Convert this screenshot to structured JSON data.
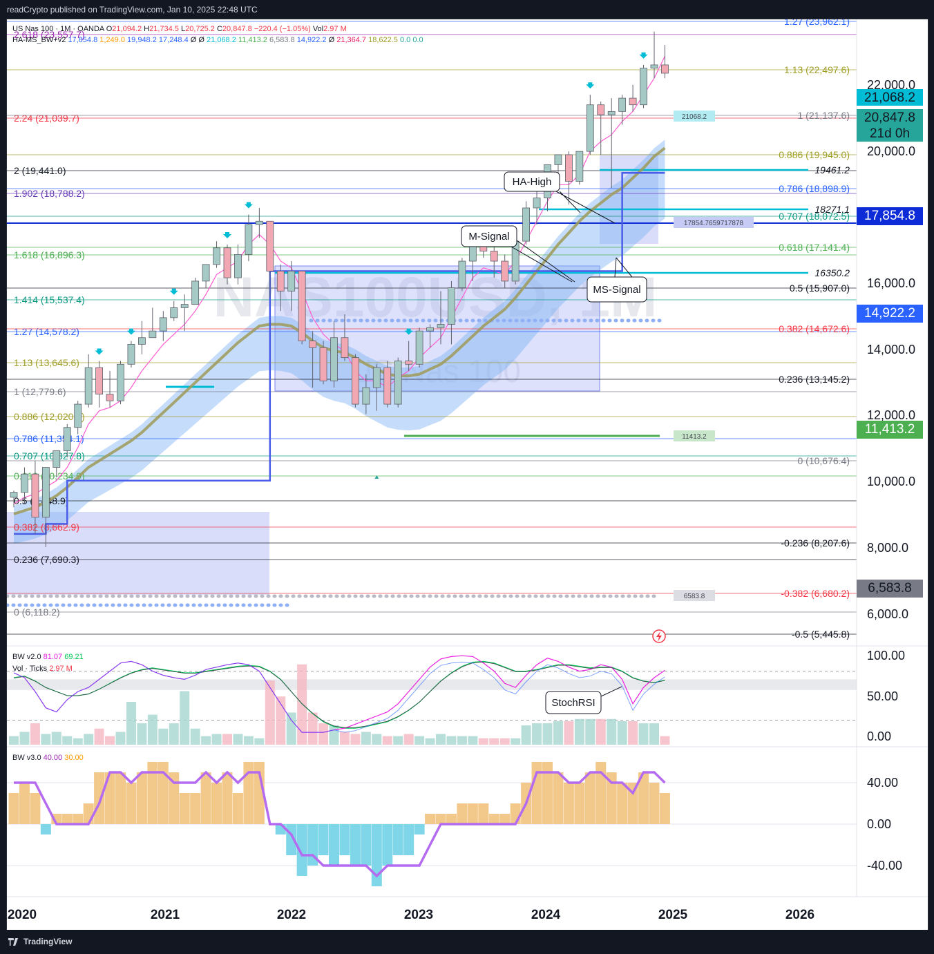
{
  "header": {
    "publisher": "readCrypto published on TradingView.com, Jan 10, 2025 22:48 UTC"
  },
  "footer": {
    "brand": "TradingView"
  },
  "legend": {
    "symbol": "US Nas 100 · 1M · OANDA",
    "ohlc": [
      {
        "k": "O",
        "v": "21,094.2"
      },
      {
        "k": "H",
        "v": "21,734.5"
      },
      {
        "k": "L",
        "v": "20,725.2"
      },
      {
        "k": "C",
        "v": "20,847.8"
      },
      {
        "k": "",
        "v": "−220.4 (−1.05%)"
      },
      {
        "k": "Vol",
        "v": "2.97 M"
      }
    ],
    "ind_name": "HA-MS_BW+v2",
    "ind_values": [
      {
        "v": "17,854.8",
        "c": "#2962ff"
      },
      {
        "v": "1,249.0",
        "c": "#ff9800"
      },
      {
        "v": "19,948.2",
        "c": "#2962ff"
      },
      {
        "v": "17,248.4",
        "c": "#2962ff"
      },
      {
        "v": "Ø",
        "c": "#131722"
      },
      {
        "v": "Ø",
        "c": "#131722"
      },
      {
        "v": "21,068.2",
        "c": "#00bcd4"
      },
      {
        "v": "11,413.2",
        "c": "#4caf50"
      },
      {
        "v": "6,583.8",
        "c": "#787b86"
      },
      {
        "v": "14,922.2",
        "c": "#2962ff"
      },
      {
        "v": "Ø",
        "c": "#131722"
      },
      {
        "v": "21,364.7",
        "c": "#e91e63"
      },
      {
        "v": "18,622.5",
        "c": "#9e9d24"
      },
      {
        "v": "0.0",
        "c": "#26a69a"
      },
      {
        "v": "0.0",
        "c": "#26a69a"
      }
    ],
    "bw2_name": "BW v2.0",
    "bw2_v1": "81.07",
    "bw2_v2": "69.21",
    "vol_name": "Vol · Ticks",
    "vol_v": "2.97 M",
    "bw3_name": "BW v3.0",
    "bw3_v1": "40.00",
    "bw3_v2": "30.00"
  },
  "watermark": {
    "symbol": "NAS100USD, 1M",
    "name": "US Nas 100"
  },
  "colors": {
    "up": "#a5c9c4",
    "down": "#f2a8b3",
    "candle_border": "#5d606b",
    "accent": "#2962ff",
    "ma": "#9e9a57",
    "fast": "#ff5bd1"
  },
  "chart_data": {
    "type": "candlestick",
    "x_axis_ticks": [
      "2020",
      "2021",
      "2022",
      "2023",
      "2024",
      "2025",
      "2026"
    ],
    "price_axis_ticks": [
      "22,000.0",
      "20,000.0",
      "18,000.0",
      "16,000.0",
      "14,000.0",
      "12,000.0",
      "10,000.0",
      "8,000.0",
      "6,000.0"
    ],
    "price_badges": [
      {
        "v": "21,068.2",
        "bg": "#00bcd4",
        "fg": "#131722"
      },
      {
        "v": "20,847.8",
        "bg": "#26a69a",
        "fg": "#131722"
      },
      {
        "v": "21d 0h",
        "bg": "#26a69a",
        "fg": "#131722"
      },
      {
        "v": "17,854.8",
        "bg": "#0d2bd6",
        "fg": "#ffffff"
      },
      {
        "v": "14,922.2",
        "bg": "#2962ff",
        "fg": "#ffffff"
      },
      {
        "v": "11,413.2",
        "bg": "#4caf50",
        "fg": "#ffffff"
      },
      {
        "v": "6,583.8",
        "bg": "#787b86",
        "fg": "#131722"
      }
    ],
    "fib_left": [
      {
        "label": "2.618 (23,557.7)",
        "c": "#9c27b0"
      },
      {
        "label": "2.24 (21,039.7)",
        "c": "#f23645"
      },
      {
        "label": "2 (19,441.0)",
        "c": "#131722"
      },
      {
        "label": "1.902 (18,788.2)",
        "c": "#673ab7"
      },
      {
        "label": "1.618 (16,896.3)",
        "c": "#4caf50"
      },
      {
        "label": "1.414 (15,537.4)",
        "c": "#089981"
      },
      {
        "label": "1.27 (14,578.2)",
        "c": "#2962ff"
      },
      {
        "label": "1.13 (13,645.6)",
        "c": "#9e9d24"
      },
      {
        "label": "1 (12,779.6)",
        "c": "#787b86"
      },
      {
        "label": "0.886 (12,020.2)",
        "c": "#9e9d24"
      },
      {
        "label": "0.786 (11,354.1)",
        "c": "#2962ff"
      },
      {
        "label": "0.707 (10,827.8)",
        "c": "#089981"
      },
      {
        "label": "0.618 (10,234.9)",
        "c": "#4caf50"
      },
      {
        "label": "0.5 (9,448.9)",
        "c": "#131722"
      },
      {
        "label": "0.382 (8,662.9)",
        "c": "#f23645"
      },
      {
        "label": "0.236 (7,690.3)",
        "c": "#131722"
      },
      {
        "label": "0 (6,118.2)",
        "c": "#787b86"
      }
    ],
    "fib_right": [
      {
        "label": "1.27 (23,962.1)",
        "c": "#2962ff"
      },
      {
        "label": "1.13 (22,497.6)",
        "c": "#9e9d24"
      },
      {
        "label": "1 (21,137.6)",
        "c": "#787b86"
      },
      {
        "label": "0.886 (19,945.0)",
        "c": "#9e9d24"
      },
      {
        "label": "0.786 (18,898.9)",
        "c": "#2962ff"
      },
      {
        "label": "0.707 (18,072.5)",
        "c": "#089981"
      },
      {
        "label": "0.618 (17,141.4)",
        "c": "#4caf50"
      },
      {
        "label": "0.5 (15,907.0)",
        "c": "#131722"
      },
      {
        "label": "0.382 (14,672.6)",
        "c": "#f23645"
      },
      {
        "label": "0.236 (13,145.2)",
        "c": "#131722"
      },
      {
        "label": "0 (10,676.4)",
        "c": "#787b86"
      },
      {
        "label": "-0.236 (8,207.6)",
        "c": "#131722"
      },
      {
        "label": "-0.382 (6,680.2)",
        "c": "#f23645"
      },
      {
        "label": "-0.5 (5,445.8)",
        "c": "#131722"
      }
    ],
    "hlines": [
      {
        "label": "19461.2",
        "c": "#00bcd4"
      },
      {
        "label": "18271.1",
        "c": "#00bcd4"
      },
      {
        "label": "16350.2",
        "c": "#00bcd4"
      }
    ],
    "line_tags": [
      {
        "label": "21068.2"
      },
      {
        "label": "17854.7659717878"
      },
      {
        "label": "11413.2"
      },
      {
        "label": "6583.8"
      }
    ],
    "callouts": [
      {
        "label": "HA-High"
      },
      {
        "label": "M-Signal"
      },
      {
        "label": "MS-Signal"
      },
      {
        "label": "StochRSI"
      }
    ],
    "bw2_axis": [
      "100.00",
      "50.00",
      "0.00"
    ],
    "bw3_axis": [
      "40.00",
      "0.00",
      "-40.00"
    ],
    "candles": [
      [
        8100,
        8300,
        7800,
        8250
      ],
      [
        8250,
        9000,
        7900,
        8800
      ],
      [
        8800,
        9200,
        7000,
        7500
      ],
      [
        7500,
        9000,
        6600,
        9000
      ],
      [
        9000,
        9500,
        8700,
        9500
      ],
      [
        9500,
        10300,
        9300,
        10200
      ],
      [
        10200,
        11000,
        10000,
        10900
      ],
      [
        10900,
        12400,
        10800,
        12000
      ],
      [
        12000,
        12200,
        10800,
        11200
      ],
      [
        11200,
        11900,
        10800,
        11000
      ],
      [
        11000,
        12200,
        10900,
        12100
      ],
      [
        12100,
        12800,
        12000,
        12700
      ],
      [
        12700,
        13400,
        12400,
        12900
      ],
      [
        12900,
        13800,
        12900,
        13100
      ],
      [
        13100,
        13700,
        12800,
        13500
      ],
      [
        13500,
        14000,
        13400,
        13800
      ],
      [
        13800,
        14200,
        13100,
        13900
      ],
      [
        13900,
        14700,
        13900,
        14600
      ],
      [
        14600,
        15100,
        14400,
        15100
      ],
      [
        15100,
        15800,
        15000,
        15600
      ],
      [
        15600,
        15700,
        14500,
        14700
      ],
      [
        14700,
        15700,
        14500,
        15400
      ],
      [
        15400,
        16600,
        15200,
        16300
      ],
      [
        16300,
        16800,
        15900,
        16400
      ],
      [
        16400,
        16400,
        14100,
        14900
      ],
      [
        14900,
        15100,
        13700,
        14300
      ],
      [
        14300,
        15200,
        13700,
        14900
      ],
      [
        14900,
        14900,
        12700,
        12800
      ],
      [
        12800,
        13100,
        11400,
        12600
      ],
      [
        12600,
        12800,
        11500,
        11600
      ],
      [
        11600,
        13400,
        11400,
        12900
      ],
      [
        12900,
        13600,
        12200,
        12300
      ],
      [
        12300,
        12400,
        10800,
        10900
      ],
      [
        10900,
        11800,
        10600,
        11400
      ],
      [
        11400,
        12100,
        10700,
        12000
      ],
      [
        12000,
        12200,
        10800,
        10900
      ],
      [
        10900,
        12300,
        10800,
        12200
      ],
      [
        12200,
        12800,
        11900,
        12100
      ],
      [
        12100,
        13200,
        12000,
        13100
      ],
      [
        13100,
        13300,
        12600,
        13200
      ],
      [
        13200,
        14300,
        12700,
        13300
      ],
      [
        13300,
        14600,
        12700,
        14400
      ],
      [
        14400,
        15300,
        14300,
        15200
      ],
      [
        15200,
        15900,
        14600,
        15800
      ],
      [
        15800,
        15900,
        15300,
        15500
      ],
      [
        15500,
        15700,
        14700,
        15200
      ],
      [
        15200,
        15400,
        14400,
        14600
      ],
      [
        14600,
        16000,
        14500,
        15800
      ],
      [
        15800,
        17000,
        15700,
        16800
      ],
      [
        16800,
        17500,
        16300,
        17100
      ],
      [
        17100,
        17700,
        16700,
        18100
      ],
      [
        18100,
        18300,
        17500,
        18400
      ],
      [
        18400,
        18500,
        16900,
        17600
      ],
      [
        17600,
        18500,
        17500,
        18500
      ],
      [
        18500,
        20200,
        18400,
        19900
      ],
      [
        19900,
        20000,
        18400,
        19600
      ],
      [
        19600,
        20100,
        17400,
        19700
      ],
      [
        19700,
        20200,
        19300,
        20100
      ],
      [
        20100,
        20500,
        19700,
        19900
      ],
      [
        19900,
        21100,
        19800,
        21000
      ],
      [
        21000,
        22100,
        20700,
        21100
      ],
      [
        21100,
        21700,
        20700,
        20850
      ]
    ],
    "ma": [
      7600,
      7700,
      7800,
      7950,
      8150,
      8400,
      8700,
      9000,
      9200,
      9400,
      9600,
      9800,
      10050,
      10350,
      10650,
      10950,
      11250,
      11550,
      11850,
      12150,
      12450,
      12750,
      13000,
      13250,
      13300,
      13300,
      13250,
      13050,
      12800,
      12600,
      12500,
      12450,
      12300,
      12100,
      11950,
      11800,
      11750,
      11750,
      11800,
      11950,
      12100,
      12350,
      12650,
      12950,
      13250,
      13500,
      13750,
      14100,
      14500,
      14900,
      15300,
      15700,
      16050,
      16400,
      16700,
      16950,
      17200,
      17400,
      17700,
      18000,
      18350,
      18600
    ],
    "fast": [
      7900,
      8100,
      8200,
      8400,
      8600,
      9000,
      9600,
      10300,
      10700,
      10800,
      11000,
      11400,
      11900,
      12300,
      12700,
      13000,
      13300,
      13700,
      14200,
      14800,
      15000,
      15200,
      15700,
      16000,
      15700,
      15200,
      15000,
      14300,
      13500,
      13000,
      12700,
      12500,
      11900,
      11600,
      11600,
      11400,
      11700,
      11900,
      12300,
      12600,
      12900,
      13500,
      14100,
      14700,
      15000,
      14900,
      14800,
      15200,
      15800,
      16400,
      17000,
      17500,
      17500,
      17800,
      18500,
      18800,
      19000,
      19400,
      19700,
      20200,
      20700,
      21360
    ],
    "ha_signal": [
      7000,
      7000,
      7000,
      7300,
      7300,
      8600,
      8600,
      8600,
      8600,
      8600,
      8600,
      8600,
      8600,
      8600,
      8600,
      8600,
      8600,
      8600,
      8600,
      8600,
      8600,
      8600,
      8600,
      8600,
      14900,
      14900,
      14900,
      14900,
      14900,
      14900,
      14900,
      14900,
      14900,
      14900,
      14900,
      14900,
      14900,
      14900,
      14900,
      14900,
      14900,
      14900,
      14900,
      14900,
      14900,
      14900,
      14900,
      14900,
      14900,
      14900,
      14900,
      14900,
      14900,
      14900,
      14900,
      14900,
      14900,
      17854,
      17854,
      17854,
      17854,
      17854
    ],
    "bw2_k": [
      78,
      72,
      55,
      35,
      30,
      45,
      55,
      60,
      70,
      80,
      90,
      92,
      88,
      80,
      75,
      72,
      70,
      75,
      82,
      85,
      88,
      90,
      88,
      80,
      60,
      40,
      20,
      5,
      5,
      5,
      8,
      10,
      15,
      20,
      25,
      30,
      40,
      55,
      70,
      85,
      95,
      98,
      99,
      98,
      90,
      80,
      65,
      60,
      75,
      88,
      96,
      92,
      85,
      80,
      82,
      88,
      85,
      70,
      40,
      60,
      72,
      81
    ],
    "bw2_d": [
      72,
      74,
      68,
      60,
      55,
      50,
      50,
      52,
      58,
      65,
      72,
      78,
      82,
      84,
      82,
      80,
      78,
      78,
      80,
      82,
      84,
      86,
      87,
      86,
      80,
      70,
      55,
      40,
      28,
      18,
      12,
      10,
      10,
      12,
      15,
      18,
      24,
      32,
      42,
      55,
      68,
      78,
      86,
      91,
      92,
      90,
      85,
      80,
      80,
      82,
      85,
      88,
      88,
      86,
      84,
      85,
      85,
      80,
      72,
      68,
      66,
      69
    ],
    "vol": [
      8,
      12,
      20,
      10,
      12,
      8,
      6,
      10,
      15,
      8,
      12,
      40,
      20,
      28,
      15,
      20,
      50,
      15,
      8,
      10,
      10,
      10,
      8,
      6,
      60,
      45,
      30,
      75,
      30,
      20,
      18,
      12,
      10,
      12,
      10,
      8,
      8,
      10,
      8,
      6,
      10,
      8,
      8,
      8,
      6,
      6,
      6,
      6,
      18,
      20,
      20,
      22,
      22,
      24,
      24,
      24,
      24,
      22,
      22,
      20,
      20,
      8
    ],
    "bw3_bars": [
      30,
      40,
      30,
      -10,
      10,
      10,
      10,
      20,
      50,
      50,
      50,
      40,
      50,
      60,
      60,
      50,
      30,
      30,
      50,
      40,
      50,
      30,
      60,
      60,
      0,
      -10,
      -30,
      -50,
      -40,
      -30,
      -40,
      -30,
      -40,
      -40,
      -60,
      -40,
      -30,
      -30,
      -10,
      10,
      10,
      10,
      20,
      20,
      20,
      10,
      10,
      20,
      40,
      60,
      60,
      50,
      40,
      40,
      50,
      60,
      50,
      40,
      40,
      50,
      40,
      30
    ],
    "bw3_line": [
      40,
      40,
      40,
      20,
      0,
      0,
      0,
      0,
      20,
      50,
      50,
      40,
      50,
      50,
      50,
      40,
      40,
      40,
      50,
      40,
      50,
      40,
      50,
      50,
      0,
      0,
      -10,
      -30,
      -30,
      -40,
      -40,
      -40,
      -40,
      -40,
      -50,
      -40,
      -40,
      -40,
      -40,
      -20,
      0,
      0,
      0,
      0,
      0,
      0,
      0,
      0,
      20,
      50,
      50,
      50,
      40,
      40,
      50,
      50,
      40,
      40,
      30,
      50,
      50,
      40
    ]
  }
}
